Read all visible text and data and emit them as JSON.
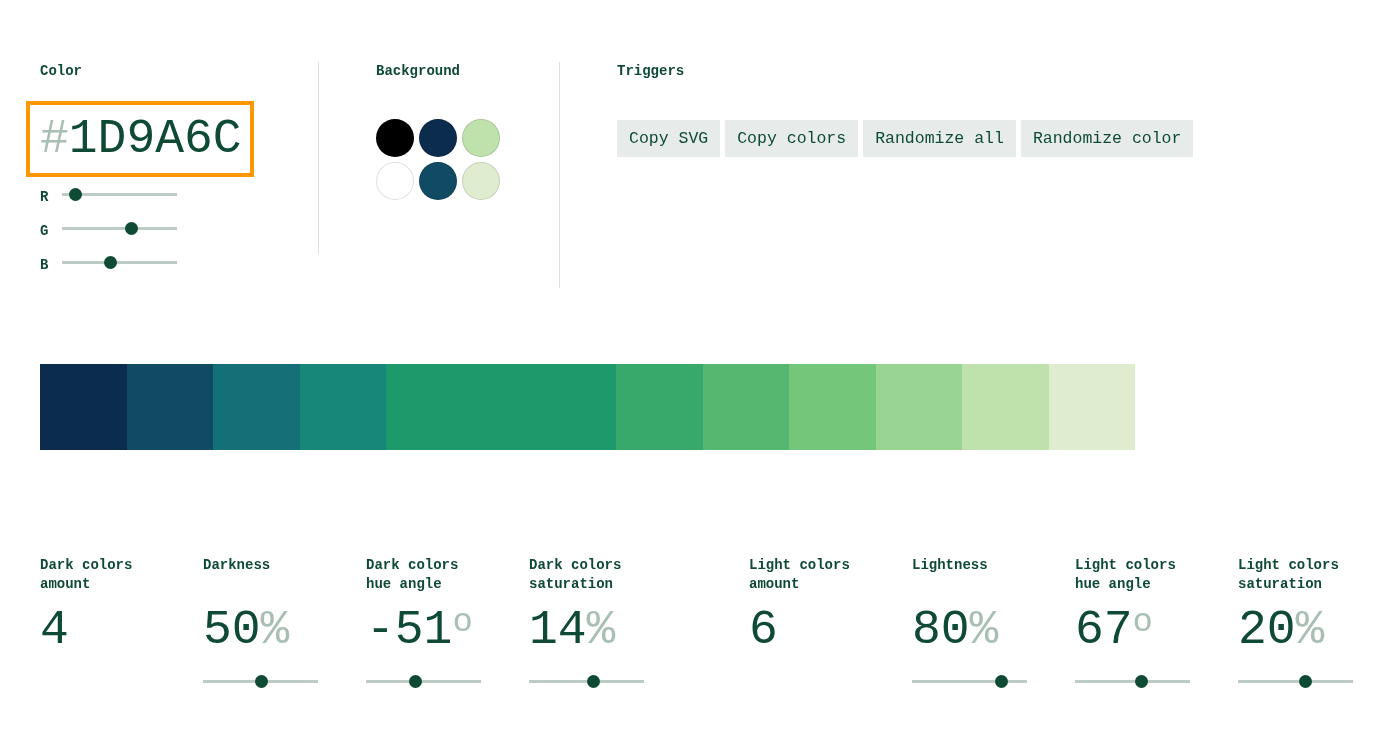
{
  "color": {
    "title": "Color",
    "hash": "#",
    "hex": "1D9A6C",
    "channels": [
      {
        "label": "R",
        "level": 0.11
      },
      {
        "label": "G",
        "level": 0.6
      },
      {
        "label": "B",
        "level": 0.42
      }
    ]
  },
  "background": {
    "title": "Background",
    "swatches": [
      {
        "color": "#000000"
      },
      {
        "color": "#0c2c4e"
      },
      {
        "color": "#bfe2ad"
      },
      {
        "color": "#ffffff"
      },
      {
        "color": "#114b63"
      },
      {
        "color": "#dfecd0"
      }
    ]
  },
  "triggers": {
    "title": "Triggers",
    "buttons": [
      "Copy SVG",
      "Copy colors",
      "Randomize all",
      "Randomize color"
    ]
  },
  "palette": [
    {
      "color": "#0c2c4e",
      "kind": "shade"
    },
    {
      "color": "#104b63",
      "kind": "shade"
    },
    {
      "color": "#156f77",
      "kind": "shade"
    },
    {
      "color": "#17877a",
      "kind": "shade"
    },
    {
      "color": "#1d9a6c",
      "kind": "base"
    },
    {
      "color": "#39a96b",
      "kind": "shade"
    },
    {
      "color": "#56b870",
      "kind": "shade"
    },
    {
      "color": "#74c67a",
      "kind": "shade"
    },
    {
      "color": "#99d492",
      "kind": "shade"
    },
    {
      "color": "#bfe2ad",
      "kind": "shade"
    },
    {
      "color": "#dfecd0",
      "kind": "shade"
    }
  ],
  "settings": [
    [
      {
        "label": "Dark colors amount",
        "value": "4"
      },
      {
        "label": "Darkness",
        "value": "50",
        "unit": "%",
        "level": 0.5
      },
      {
        "label": "Dark colors hue angle",
        "value": "-51",
        "unit": "o",
        "level": 0.43
      },
      {
        "label": "Dark colors saturation",
        "value": "14",
        "unit": "%",
        "level": 0.56
      }
    ],
    [
      {
        "label": "Light colors amount",
        "value": "6"
      },
      {
        "label": "Lightness",
        "value": "80",
        "unit": "%",
        "level": 0.77
      },
      {
        "label": "Light colors hue angle",
        "value": "67",
        "unit": "o",
        "level": 0.57
      },
      {
        "label": "Light colors saturation",
        "value": "20",
        "unit": "%",
        "level": 0.58
      }
    ]
  ]
}
